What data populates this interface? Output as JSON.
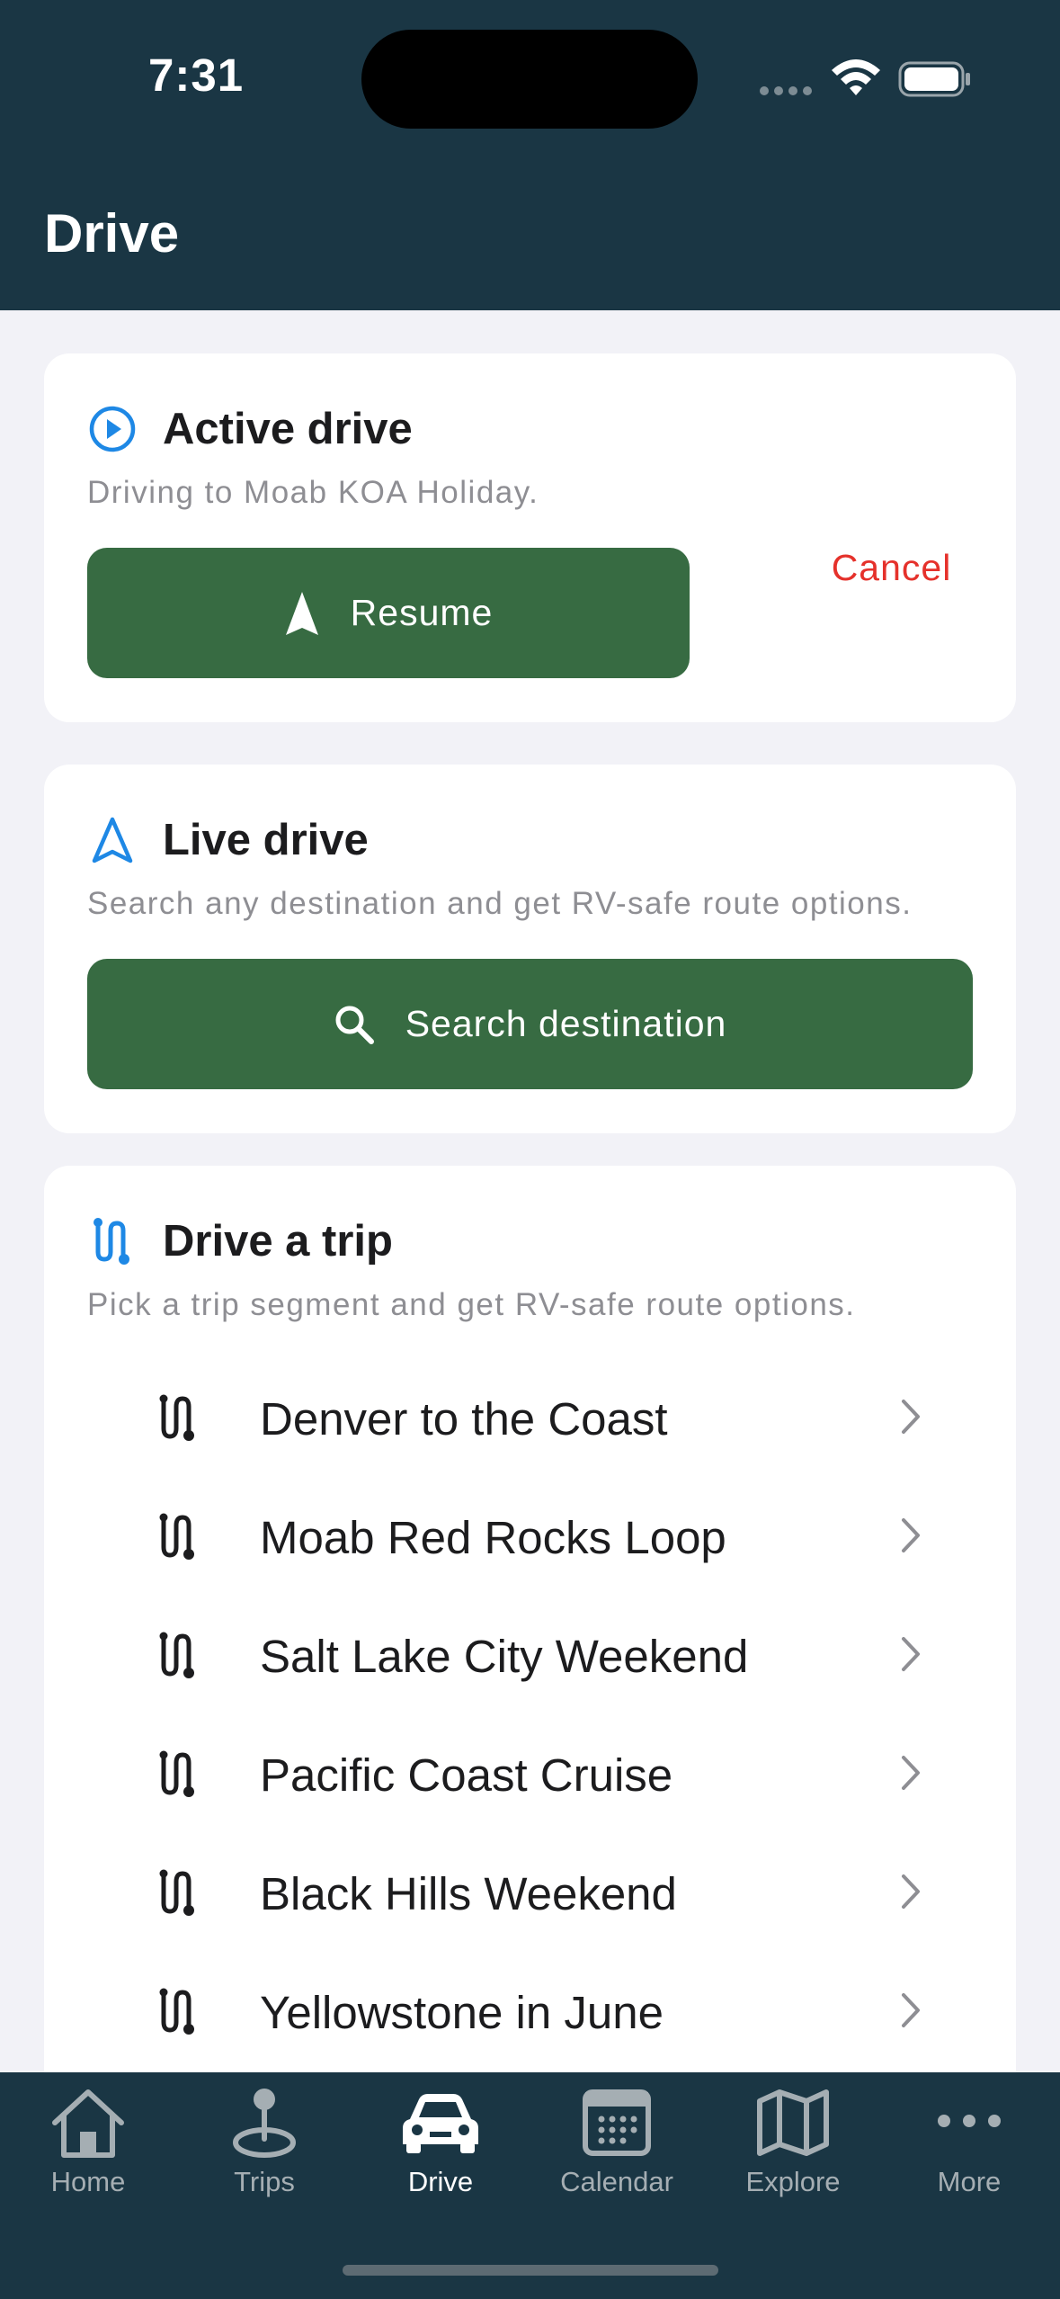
{
  "status_bar": {
    "time": "7:31"
  },
  "header": {
    "title": "Drive"
  },
  "active_drive": {
    "title": "Active drive",
    "subtitle": "Driving to Moab KOA Holiday.",
    "resume_label": "Resume",
    "cancel_label": "Cancel"
  },
  "live_drive": {
    "title": "Live drive",
    "subtitle": "Search any destination and get RV-safe route options.",
    "search_label": "Search destination"
  },
  "drive_trip": {
    "title": "Drive a trip",
    "subtitle": "Pick a trip segment and get RV-safe route options.",
    "trips": [
      {
        "label": "Denver to the Coast"
      },
      {
        "label": "Moab Red Rocks Loop"
      },
      {
        "label": "Salt Lake City Weekend"
      },
      {
        "label": "Pacific Coast Cruise"
      },
      {
        "label": "Black Hills Weekend"
      },
      {
        "label": "Yellowstone in June"
      }
    ]
  },
  "tabbar": {
    "tabs": [
      {
        "label": "Home",
        "icon": "house-icon"
      },
      {
        "label": "Trips",
        "icon": "pin-icon"
      },
      {
        "label": "Drive",
        "icon": "car-icon",
        "active": true
      },
      {
        "label": "Calendar",
        "icon": "calendar-icon"
      },
      {
        "label": "Explore",
        "icon": "map-icon"
      },
      {
        "label": "More",
        "icon": "ellipsis-icon"
      }
    ]
  },
  "colors": {
    "header_bg": "#1a3644",
    "accent_blue": "#1e88e5",
    "button_green": "#376b42",
    "cancel_red": "#e5312b"
  }
}
